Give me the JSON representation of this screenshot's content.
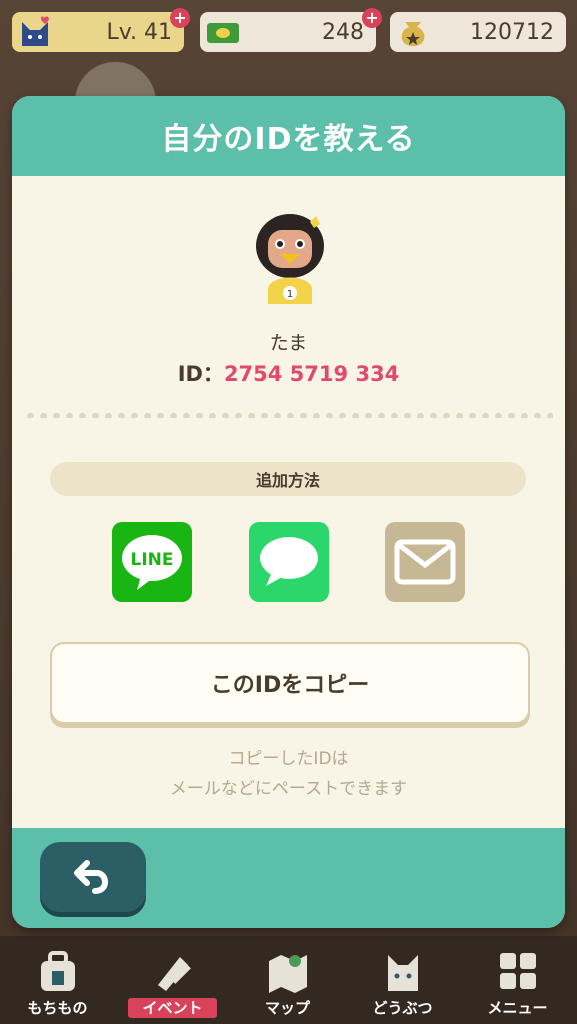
{
  "status": {
    "level": "Lv. 41",
    "tickets": "248",
    "bells": "120712"
  },
  "dialog": {
    "title": "自分のIDを教える",
    "player_name": "たま",
    "id_label": "ID：",
    "id_value": "2754 5719 334",
    "avatar_badge": "1",
    "method_label": "追加方法",
    "share_line_label": "LINE",
    "copy_button": "このIDをコピー",
    "hint_line1": "コピーしたIDは",
    "hint_line2": "メールなどにペーストできます"
  },
  "colors": {
    "teal": "#5bbfaa",
    "id_pink": "#e24a6b",
    "line_green": "#19b513",
    "message_green": "#2bd66a",
    "mail_beige": "#c7b895"
  },
  "nav": {
    "items": [
      {
        "label": "もちもの",
        "icon": "bag-icon"
      },
      {
        "label": "イベント",
        "icon": "event-icon"
      },
      {
        "label": "マップ",
        "icon": "map-icon"
      },
      {
        "label": "どうぶつ",
        "icon": "animal-icon"
      },
      {
        "label": "メニュー",
        "icon": "menu-grid-icon"
      }
    ],
    "active": "イベント"
  }
}
